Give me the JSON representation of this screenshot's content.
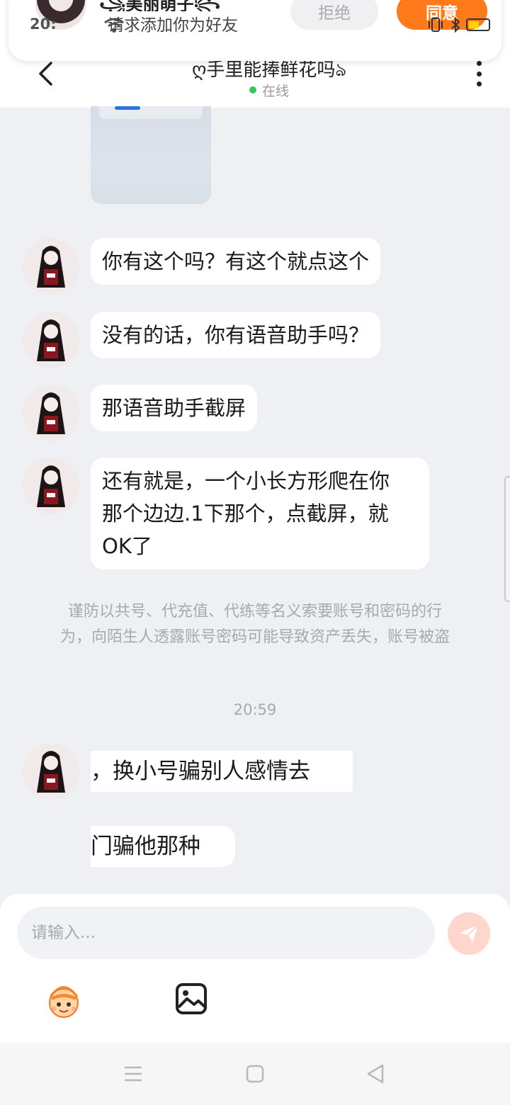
{
  "notification": {
    "name": "꧁美丽萌子꧂",
    "subtitle": "请求添加你为好友",
    "time": "20:",
    "reject_label": "拒绝",
    "agree_label": "同意",
    "agree_color": "#ff7a1a"
  },
  "header": {
    "title": "ღ手里能捧鲜花吗ঌ",
    "status": "在线",
    "status_color": "#33c659",
    "back_icon": "chevron-left-icon",
    "more_icon": "more-vertical-icon"
  },
  "messages": [
    {
      "text": "你有这个吗？有这个就点这个"
    },
    {
      "text": "没有的话，你有语音助手吗？"
    },
    {
      "text": "那语音助手截屏"
    },
    {
      "lines": [
        "还有就是，一个小长方形爬在你",
        "那个边边.1下那个，点截屏，就",
        "OK了"
      ]
    }
  ],
  "notice": {
    "lines": [
      "谨防以共号、代充值、代练等名义索要账号和密码的行",
      "为，向陌生人透露账号密码可能导致资产丢失，账号被盗"
    ]
  },
  "timestamp": "20:59",
  "partial_messages": [
    {
      "text": "，换小号骗别人感情去"
    },
    {
      "text": "门骗他那种"
    }
  ],
  "input": {
    "placeholder": "请输入...",
    "send_icon": "send-icon",
    "emoji_icon": "emoji-mascot-icon",
    "image_icon": "image-icon"
  },
  "navbar": {
    "menu_icon": "menu-icon",
    "home_icon": "square-home-icon",
    "back_icon": "triangle-back-icon"
  }
}
